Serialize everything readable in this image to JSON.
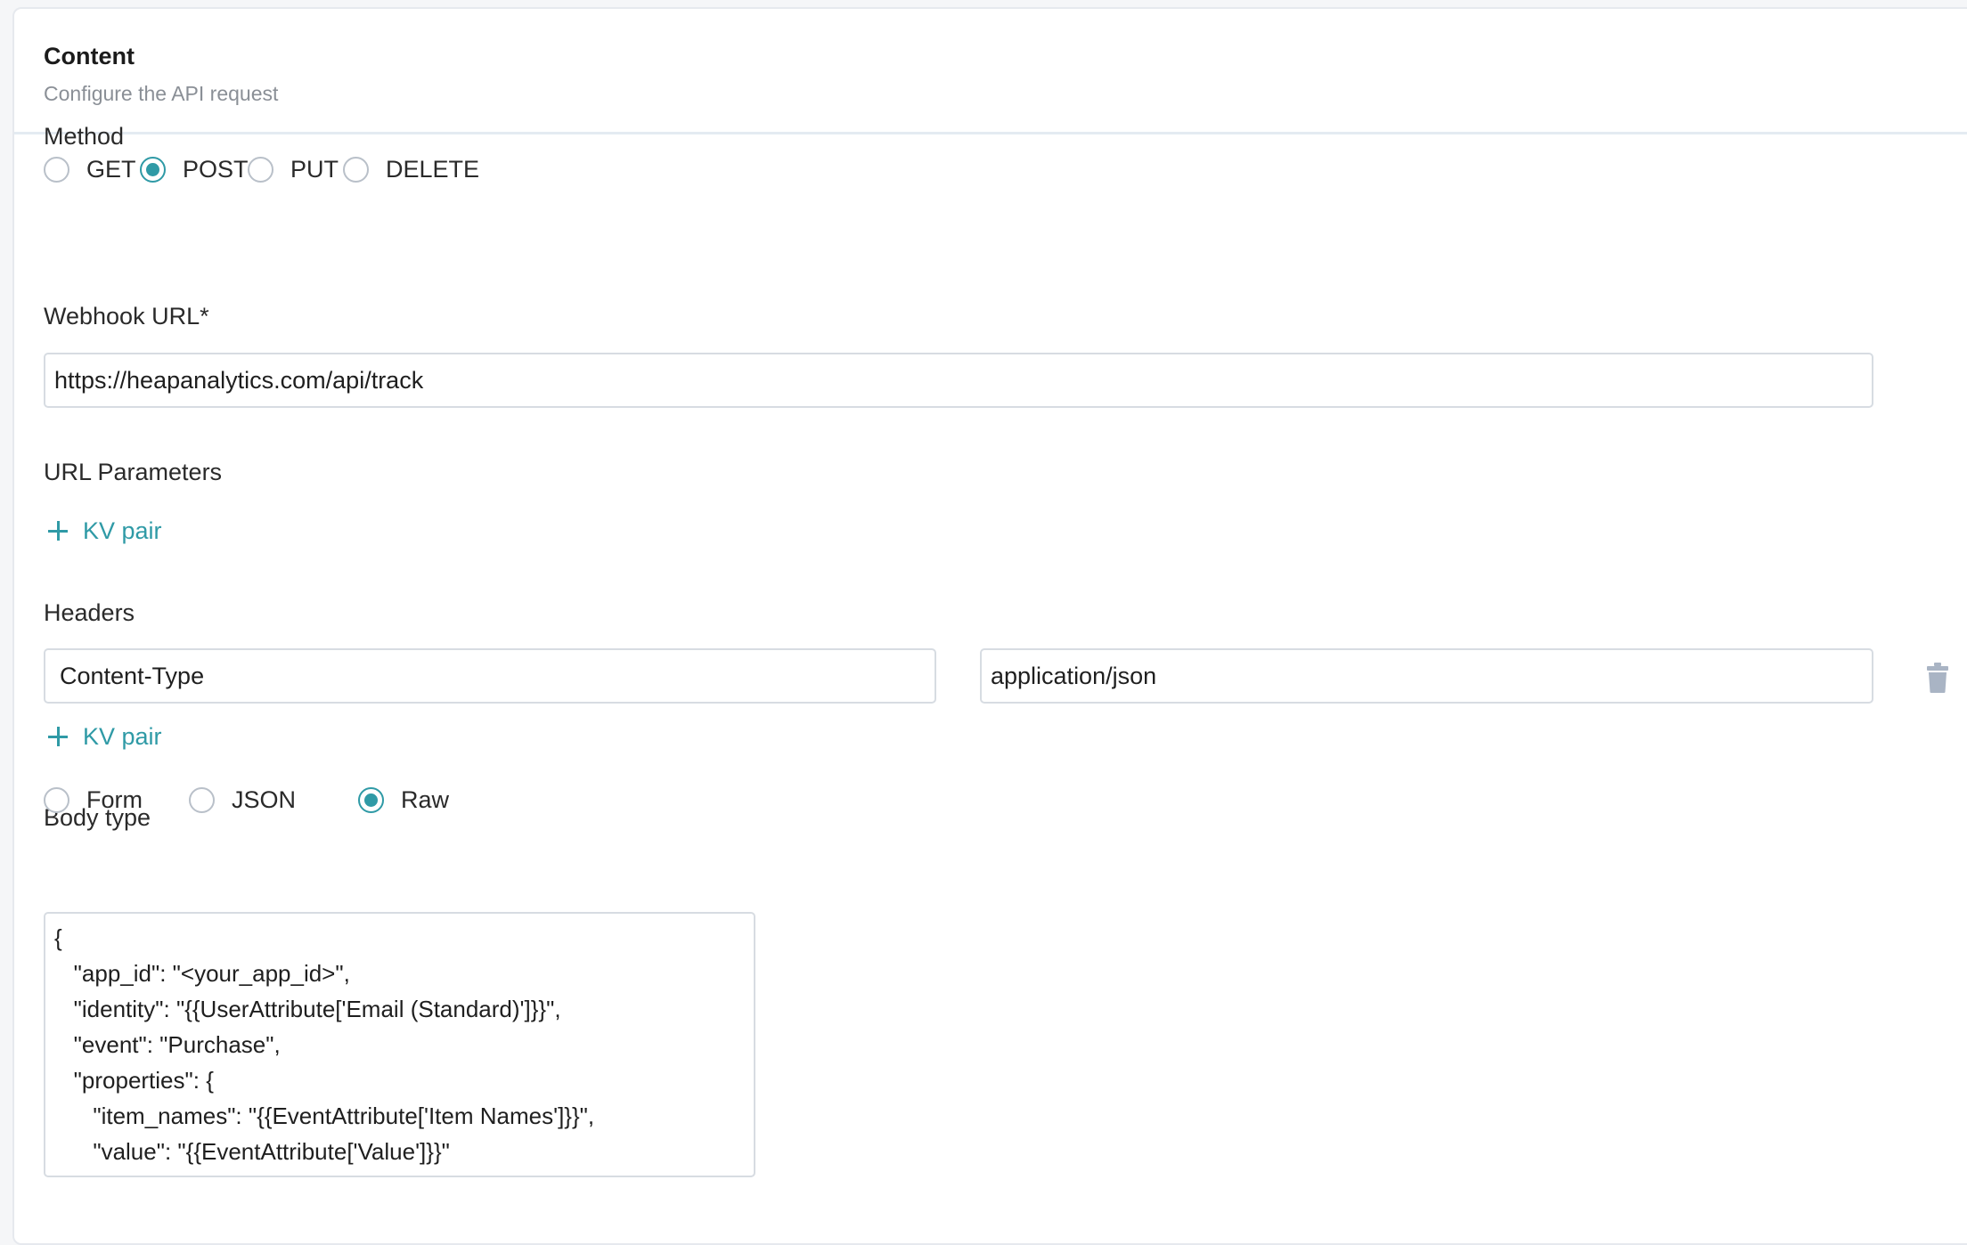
{
  "header": {
    "title": "Content",
    "subtitle": "Configure the API request"
  },
  "method": {
    "label": "Method",
    "options": [
      "GET",
      "POST",
      "PUT",
      "DELETE"
    ],
    "selected": "POST"
  },
  "webhook": {
    "label": "Webhook URL*",
    "value": "https://heapanalytics.com/api/track"
  },
  "url_params": {
    "label": "URL Parameters",
    "add_label": "KV pair"
  },
  "headers": {
    "label": "Headers",
    "rows": [
      {
        "key": "Content-Type",
        "value": "application/json"
      }
    ],
    "add_label": "KV pair",
    "delete_icon": "trash-icon"
  },
  "body_type": {
    "label": "Body type",
    "options": [
      "Form",
      "JSON",
      "Raw"
    ],
    "selected": "Raw"
  },
  "body": {
    "lines": [
      "{",
      "   \"app_id\": \"<your_app_id>\",",
      "   \"identity\": \"{{UserAttribute['Email (Standard)']}}\",",
      "   \"event\": \"Purchase\",",
      "   \"properties\": {",
      "      \"item_names\": \"{{EventAttribute['Item Names']}}\",",
      "      \"value\": \"{{EventAttribute['Value']}}\""
    ]
  },
  "colors": {
    "accent": "#2f9aa6",
    "border": "#d7dce2",
    "muted_text": "#8a8f96",
    "trash_icon": "#a9b4c4"
  }
}
